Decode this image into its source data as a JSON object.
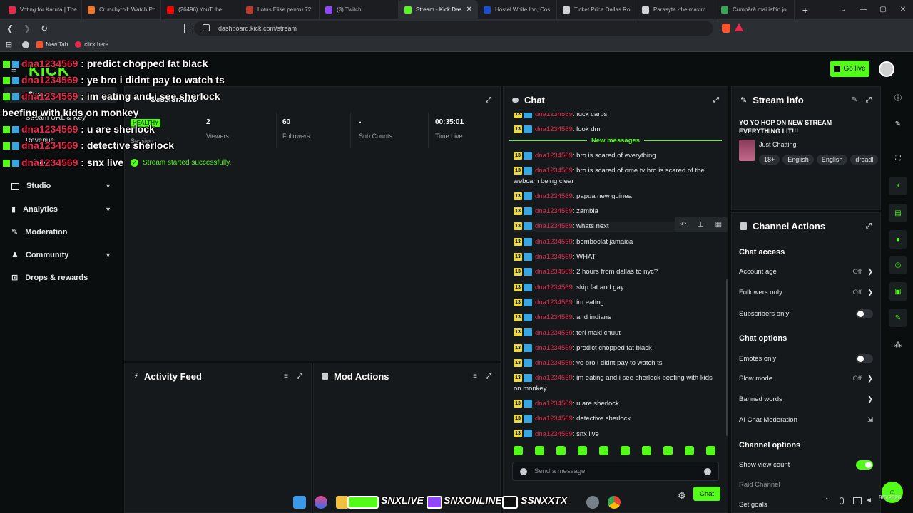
{
  "browser": {
    "tabs": [
      {
        "title": "Voting for Karuta | The",
        "color": "#e8294a"
      },
      {
        "title": "Crunchyroll: Watch Po",
        "color": "#f47521"
      },
      {
        "title": "(26496) YouTube",
        "color": "#ff0000"
      },
      {
        "title": "Lotus Elise pentru 72.",
        "color": "#c0392b"
      },
      {
        "title": "(3) Twitch",
        "color": "#9146ff"
      },
      {
        "title": "Stream - Kick Das",
        "color": "#53fc18",
        "active": true
      },
      {
        "title": "Hostel White Inn, Cos",
        "color": "#1a4fcf"
      },
      {
        "title": "Ticket Price Dallas Ro",
        "color": "#cfd2d6"
      },
      {
        "title": "Parasyte -the maxim",
        "color": "#cfd2d6"
      },
      {
        "title": "Cumpără mai ieftin jo",
        "color": "#34a853"
      }
    ],
    "url": "dashboard.kick.com/stream",
    "bookmarks": [
      {
        "label": "New Tab"
      },
      {
        "label": "click here"
      }
    ]
  },
  "header": {
    "logo": "KICK",
    "go_live": "Go live"
  },
  "sidebar": {
    "items": [
      {
        "label": "Stream"
      },
      {
        "label": "Stream URL & Key"
      },
      {
        "label": "Revenue"
      },
      {
        "label": "Achievements"
      },
      {
        "label": "Studio",
        "chevron": true
      },
      {
        "label": "Analytics",
        "chevron": true
      },
      {
        "label": "Moderation"
      },
      {
        "label": "Community",
        "chevron": true
      },
      {
        "label": "Drops & rewards"
      }
    ]
  },
  "session": {
    "title": "Session info",
    "health": "HEALTHY",
    "health_label": "Session",
    "stats": [
      {
        "value": "2",
        "label": "Viewers"
      },
      {
        "value": "60",
        "label": "Followers"
      },
      {
        "value": "-",
        "label": "Sub Counts"
      },
      {
        "value": "00:35:01",
        "label": "Time Live"
      }
    ],
    "success": "Stream started successfully."
  },
  "activity": {
    "title": "Activity Feed"
  },
  "mod": {
    "title": "Mod Actions"
  },
  "chat": {
    "title": "Chat",
    "new_messages": "New messages",
    "badge": "13",
    "username": "dna1234569",
    "messages_before": [
      {
        "text": ": fuck carbs"
      },
      {
        "text": ": look dm"
      }
    ],
    "messages": [
      {
        "text": ": bro is scared of everything"
      },
      {
        "text": ": bro is scared of ome tv bro is scared of the webcam being clear"
      },
      {
        "text": ": papua new guinea"
      },
      {
        "text": ": zambia"
      },
      {
        "text": ": whats next"
      },
      {
        "text": ": bomboclat jamaica"
      },
      {
        "text": ": WHAT"
      },
      {
        "text": ": 2 hours from dallas to nyc?"
      },
      {
        "text": ": skip fat and gay"
      },
      {
        "text": ": im eating"
      },
      {
        "text": ": and indians"
      },
      {
        "text": ": teri maki chuut"
      },
      {
        "text": ": predict chopped fat black"
      },
      {
        "text": ": ye bro i didnt pay to watch ts"
      },
      {
        "text": ": im eating and i see sherlock beefing with kids on monkey"
      },
      {
        "text": ": u are sherlock"
      },
      {
        "text": ": detective sherlock"
      },
      {
        "text": ": snx live"
      }
    ],
    "placeholder": "Send a message",
    "send": "Chat"
  },
  "stream_info": {
    "title": "Stream info",
    "stream_title": "YO YO HOP ON NEW STREAM EVERYTHING LIT!!!",
    "category": "Just Chatting",
    "tags": [
      "18+",
      "English",
      "English",
      "dreadl"
    ]
  },
  "channel_actions": {
    "title": "Channel Actions",
    "chat_access": "Chat access",
    "account_age": {
      "label": "Account age",
      "value": "Off"
    },
    "followers_only": {
      "label": "Followers only",
      "value": "Off"
    },
    "subscribers_only": {
      "label": "Subscribers only",
      "on": false
    },
    "chat_options": "Chat options",
    "emotes_only": {
      "label": "Emotes only",
      "on": false
    },
    "slow_mode": {
      "label": "Slow mode",
      "value": "Off"
    },
    "banned_words": {
      "label": "Banned words"
    },
    "ai_moderation": {
      "label": "AI Chat Moderation"
    },
    "channel_options": "Channel options",
    "show_view_count": {
      "label": "Show view count",
      "on": true
    },
    "raid_channel": {
      "label": "Raid Channel"
    },
    "set_goals": {
      "label": "Set goals"
    }
  },
  "overlay": {
    "lines": [
      {
        "user": "dna1234569",
        "msg": " : predict chopped fat black"
      },
      {
        "user": "dna1234569",
        "msg": " : ye bro i didnt pay to watch ts"
      },
      {
        "user": "dna1234569",
        "msg": " : im eating and i see sherlock"
      },
      {
        "user": "",
        "msg": "beefing with kids on monkey"
      },
      {
        "user": "dna1234569",
        "msg": " : u are sherlock"
      },
      {
        "user": "dna1234569",
        "msg": " : detective sherlock"
      },
      {
        "user": "dna1234569",
        "msg": " : snx live"
      }
    ]
  },
  "taskbar": {
    "labels": [
      "SNXLIVE",
      "SNXONLINE",
      "SSNXXTX"
    ],
    "time": "8/6/2026"
  }
}
